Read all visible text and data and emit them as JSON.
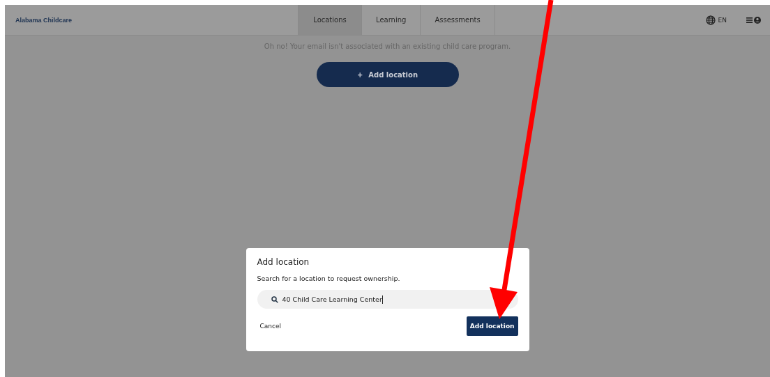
{
  "header": {
    "brand": "Alabama Childcare",
    "tabs": [
      {
        "label": "Locations",
        "selected": true
      },
      {
        "label": "Learning",
        "selected": false
      },
      {
        "label": "Assessments",
        "selected": false
      }
    ],
    "language": "EN"
  },
  "notice": "Oh no! Your email isn't associated with an existing child care program.",
  "add_button": {
    "icon": "+",
    "label": "Add location"
  },
  "dialog": {
    "title": "Add location",
    "prompt": "Search for a location to request ownership.",
    "search_value": "40 Child Care Learning Center",
    "cancel": "Cancel",
    "confirm": "Add location"
  }
}
